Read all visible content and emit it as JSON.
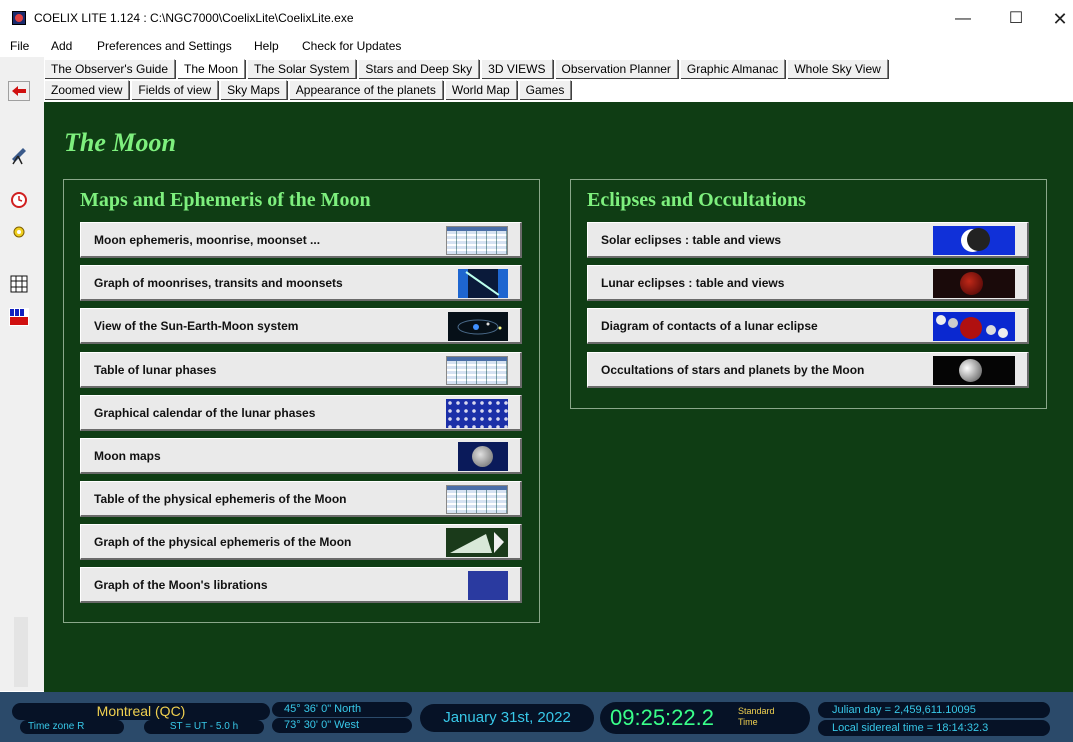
{
  "window": {
    "title": "COELIX LITE 1.124 : C:\\NGC7000\\CoelixLite\\CoelixLite.exe",
    "min_glyph": "—",
    "max_glyph": "☐",
    "close_glyph": "✕"
  },
  "menu": [
    "File",
    "Add",
    "Preferences and Settings",
    "Help",
    "Check for Updates"
  ],
  "tabs_row1": [
    "The Observer's Guide",
    "The Moon",
    "The Solar System",
    "Stars and Deep Sky",
    "3D VIEWS",
    "Observation Planner",
    "Graphic Almanac",
    "Whole Sky View"
  ],
  "tabs_row2": [
    "Zoomed view",
    "Fields of view",
    "Sky Maps",
    "Appearance of the planets",
    "World Map",
    "Games"
  ],
  "active_tab": "The Moon",
  "page_title": "The Moon",
  "left_panel": {
    "title": "Maps and Ephemeris of the Moon",
    "items": [
      "Moon ephemeris, moonrise, moonset ...",
      "Graph of moonrises, transits and moonsets",
      "View of the Sun-Earth-Moon system",
      "Table of lunar phases",
      "Graphical calendar of the lunar phases",
      "Moon maps",
      "Table of the physical ephemeris of the Moon",
      "Graph of the physical ephemeris of the Moon",
      "Graph of the Moon's librations"
    ]
  },
  "right_panel": {
    "title": "Eclipses and Occultations",
    "items": [
      "Solar eclipses : table and views",
      "Lunar eclipses : table and views",
      "Diagram of contacts of a lunar eclipse",
      "Occultations of stars and planets by the Moon"
    ]
  },
  "status": {
    "city": "Montreal (QC)",
    "timezone": "Time zone R",
    "st_offset": "ST = UT - 5.0 h",
    "latitude": "45° 36' 0\" North",
    "longitude": "73° 30' 0\" West",
    "date": "January 31st, 2022",
    "time": "09:25:22.2",
    "time_kind_1": "Standard",
    "time_kind_2": "Time",
    "julian_day": "Julian day = 2,459,611.10095",
    "sidereal": "Local sidereal time = 18:14:32.3"
  },
  "colors": {
    "main_bg": "#0f3d14",
    "heading_green": "#7ef07e",
    "status_bg": "#2b4a6a",
    "clock_green": "#39ff8a",
    "city_yellow": "#f0d050"
  },
  "icons": {
    "back": "left-arrow-icon",
    "telescope": "telescope-icon",
    "clock": "clock-icon",
    "sun": "sun-icon",
    "grid": "grid-icon",
    "chart": "chart-icon"
  }
}
